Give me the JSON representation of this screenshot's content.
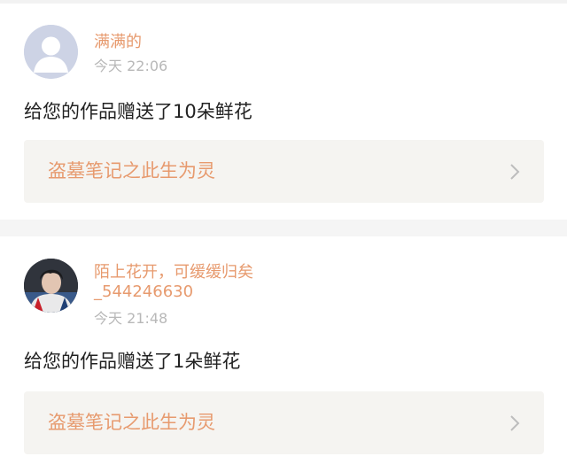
{
  "notifications": [
    {
      "user_name": "满满的",
      "time": "今天 22:06",
      "message": "给您的作品赠送了10朵鲜花",
      "work_title": "盗墓笔记之此生为灵",
      "avatar": "default-avatar-icon"
    },
    {
      "user_name": "陌上花开，可缓缓归矣_544246630",
      "time": "今天 21:48",
      "message": "给您的作品赠送了1朵鲜花",
      "work_title": "盗墓笔记之此生为灵",
      "avatar": "profile-photo"
    }
  ],
  "colors": {
    "accent": "#e79a6e",
    "time": "#b8b8b8",
    "work_bg": "#f5f4f1",
    "page_bg": "#f5f5f5"
  }
}
